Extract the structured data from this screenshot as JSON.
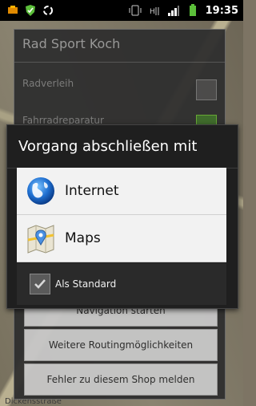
{
  "status_bar": {
    "icons": [
      "notification-icon",
      "shield-icon",
      "recycle-icon",
      "vibrate-icon",
      "network-icon",
      "signal-icon",
      "battery-icon"
    ],
    "time": "19:35"
  },
  "shop_dialog": {
    "title": "Rad Sport Koch",
    "rows": [
      {
        "label": "Radverleih"
      },
      {
        "label": "Fahrradreparatur"
      }
    ],
    "buttons": [
      {
        "label": "Navigation starten"
      },
      {
        "label": "Weitere Routingmöglichkeiten"
      },
      {
        "label": "Fehler zu diesem Shop melden"
      }
    ]
  },
  "chooser": {
    "title": "Vorgang abschließen mit",
    "options": [
      {
        "label": "Internet",
        "icon": "globe-icon"
      },
      {
        "label": "Maps",
        "icon": "maps-icon"
      }
    ],
    "default_label": "Als Standard",
    "default_checked": true
  },
  "map": {
    "street_label": "Dickensstraße"
  }
}
